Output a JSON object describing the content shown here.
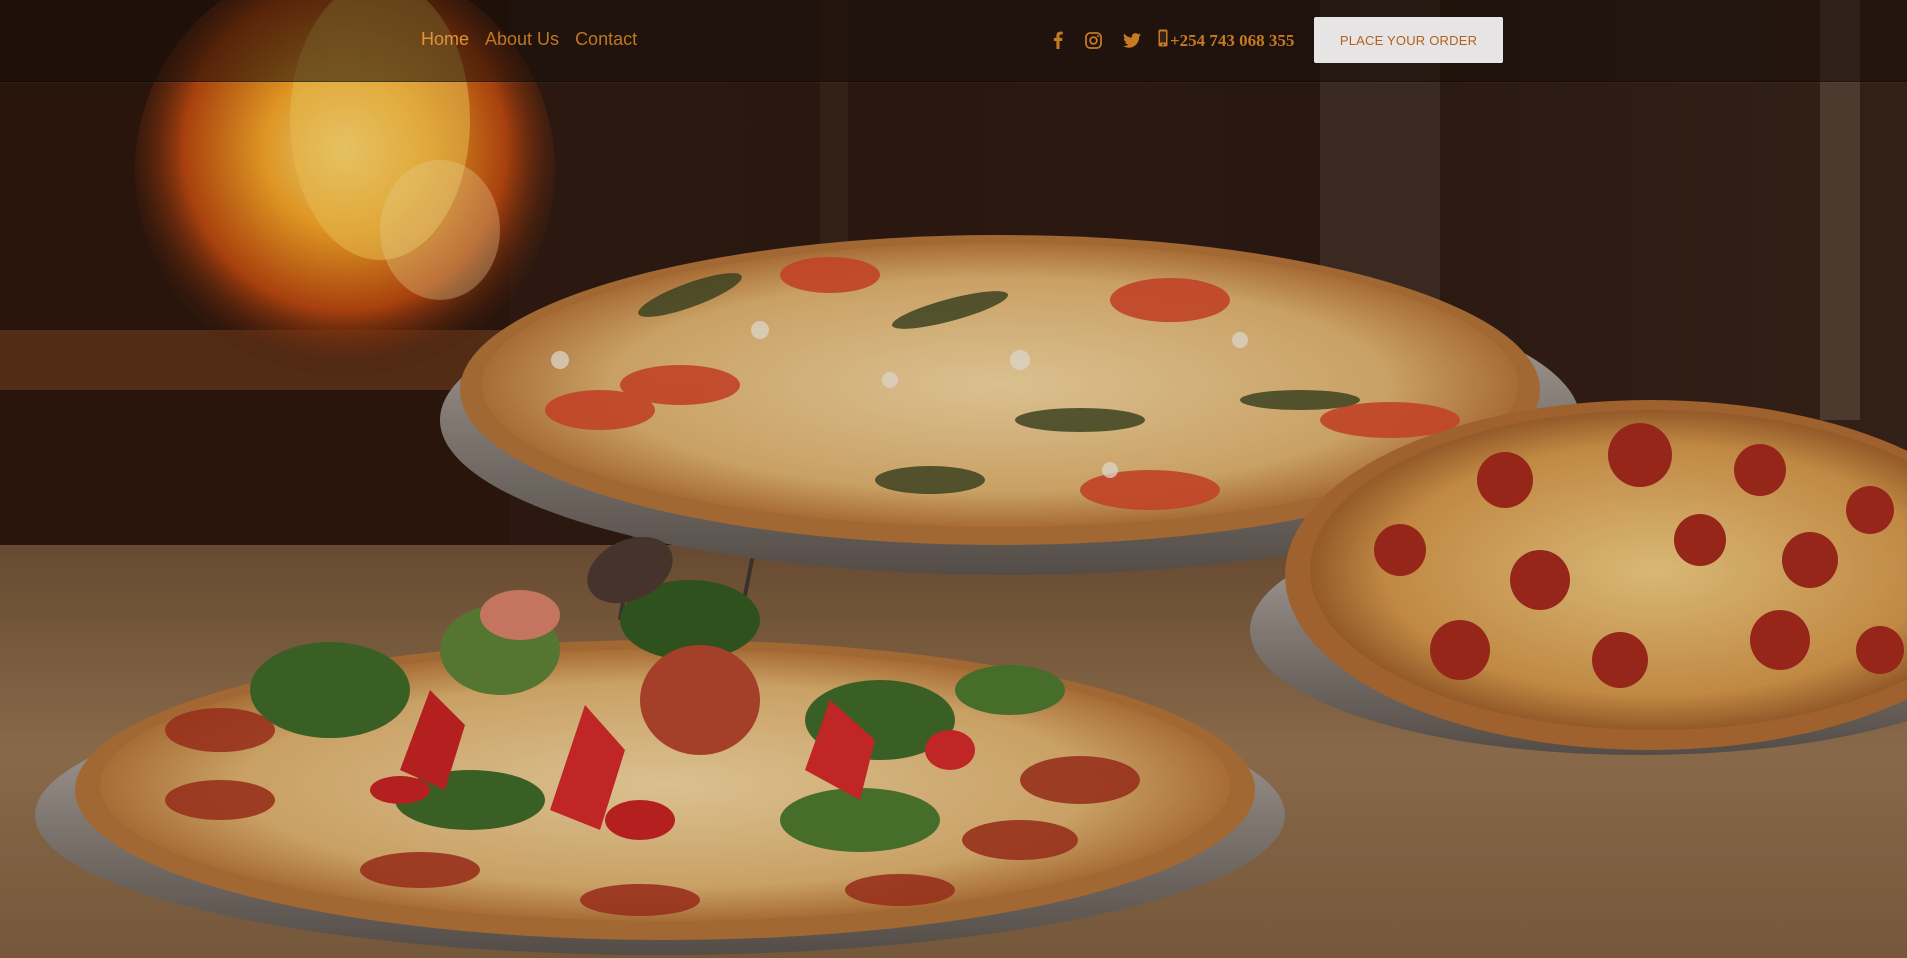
{
  "nav": {
    "links": [
      {
        "label": "Home",
        "active": true
      },
      {
        "label": "About Us",
        "active": false
      },
      {
        "label": "Contact",
        "active": false
      }
    ]
  },
  "social": {
    "icons": [
      "facebook-icon",
      "instagram-icon",
      "twitter-icon",
      "phone-icon"
    ],
    "phone": "+254 743 068 355"
  },
  "cta": {
    "label": "PLACE YOUR ORDER"
  },
  "colors": {
    "accent": "#c57a23",
    "active_link": "#e0933a",
    "button_bg": "#e6e4e4",
    "button_text": "#b2601b",
    "navbar_bg": "#180e0a"
  },
  "hero": {
    "image": "pizza-hero-image"
  }
}
